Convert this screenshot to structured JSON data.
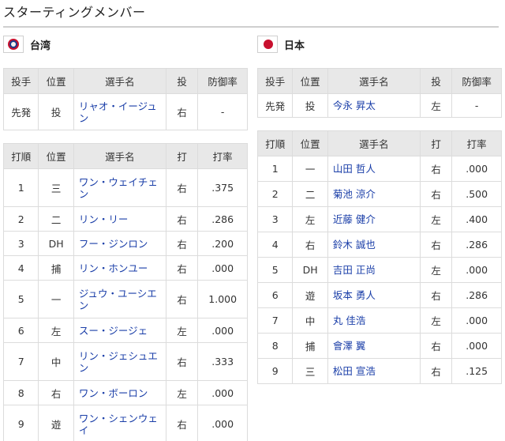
{
  "section_title": "スターティングメンバー",
  "teams": [
    {
      "name": "台湾",
      "flag_icon": "taiwan-flag-icon",
      "pitcher_headers": [
        "投手",
        "位置",
        "選手名",
        "投",
        "防御率"
      ],
      "pitcher": {
        "role": "先発",
        "pos": "投",
        "name": "リャオ・イージュン",
        "throws": "右",
        "era": "-"
      },
      "batter_headers": [
        "打順",
        "位置",
        "選手名",
        "打",
        "打率"
      ],
      "batters": [
        {
          "order": "1",
          "pos": "三",
          "name": "ワン・ウェイチェン",
          "bats": "右",
          "avg": ".375"
        },
        {
          "order": "2",
          "pos": "二",
          "name": "リン・リー",
          "bats": "右",
          "avg": ".286"
        },
        {
          "order": "3",
          "pos": "DH",
          "name": "フー・ジンロン",
          "bats": "右",
          "avg": ".200"
        },
        {
          "order": "4",
          "pos": "捕",
          "name": "リン・ホンユー",
          "bats": "右",
          "avg": ".000"
        },
        {
          "order": "5",
          "pos": "一",
          "name": "ジュウ・ユーシエン",
          "bats": "右",
          "avg": "1.000"
        },
        {
          "order": "6",
          "pos": "左",
          "name": "スー・ジージェ",
          "bats": "左",
          "avg": ".000"
        },
        {
          "order": "7",
          "pos": "中",
          "name": "リン・ジェシュエン",
          "bats": "右",
          "avg": ".333"
        },
        {
          "order": "8",
          "pos": "右",
          "name": "ワン・ボーロン",
          "bats": "左",
          "avg": ".000"
        },
        {
          "order": "9",
          "pos": "遊",
          "name": "ワン・シェンウェイ",
          "bats": "右",
          "avg": ".000"
        }
      ]
    },
    {
      "name": "日本",
      "flag_icon": "japan-flag-icon",
      "pitcher_headers": [
        "投手",
        "位置",
        "選手名",
        "投",
        "防御率"
      ],
      "pitcher": {
        "role": "先発",
        "pos": "投",
        "name": "今永 昇太",
        "throws": "左",
        "era": "-"
      },
      "batter_headers": [
        "打順",
        "位置",
        "選手名",
        "打",
        "打率"
      ],
      "batters": [
        {
          "order": "1",
          "pos": "一",
          "name": "山田 哲人",
          "bats": "右",
          "avg": ".000"
        },
        {
          "order": "2",
          "pos": "二",
          "name": "菊池 涼介",
          "bats": "右",
          "avg": ".500"
        },
        {
          "order": "3",
          "pos": "左",
          "name": "近藤 健介",
          "bats": "左",
          "avg": ".400"
        },
        {
          "order": "4",
          "pos": "右",
          "name": "鈴木 誠也",
          "bats": "右",
          "avg": ".286"
        },
        {
          "order": "5",
          "pos": "DH",
          "name": "吉田 正尚",
          "bats": "左",
          "avg": ".000"
        },
        {
          "order": "6",
          "pos": "遊",
          "name": "坂本 勇人",
          "bats": "右",
          "avg": ".286"
        },
        {
          "order": "7",
          "pos": "中",
          "name": "丸 佳浩",
          "bats": "左",
          "avg": ".000"
        },
        {
          "order": "8",
          "pos": "捕",
          "name": "會澤 翼",
          "bats": "右",
          "avg": ".000"
        },
        {
          "order": "9",
          "pos": "三",
          "name": "松田 宣浩",
          "bats": "右",
          "avg": ".125"
        }
      ]
    }
  ]
}
